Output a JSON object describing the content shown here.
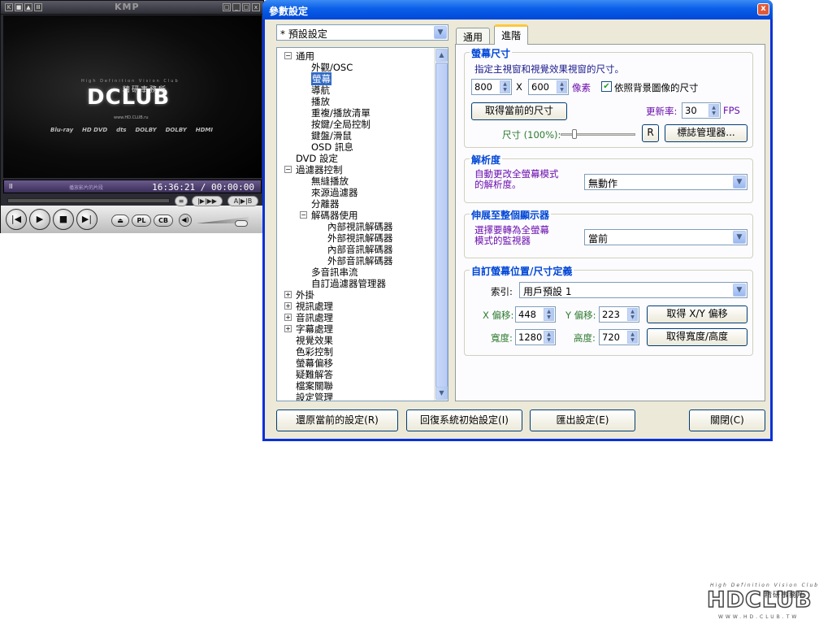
{
  "player": {
    "title": "KMP",
    "titlebar_buttons": [
      "K",
      "■",
      "▲",
      "Ⅲ"
    ],
    "window_buttons": [
      "□",
      "_",
      "□",
      "x"
    ],
    "logo_tagline": "High Definition Vision Club",
    "logo_main": "DCLUB",
    "logo_cn": "精研事務所",
    "logo_url": "www.HD.CLUB.ru",
    "formats": [
      "Blu-ray",
      "HD DVD",
      "dts",
      "DOLBY",
      "DOLBY",
      "HDMI"
    ],
    "play_indicator": "II",
    "status_text": "播放影片的片段",
    "timecode": "16:36:21 / 00:00:00",
    "buttons": {
      "list": "≡",
      "frame": "|▶|▶▶",
      "ab": "A|▶|B",
      "pl": "PL",
      "cb": "CB"
    }
  },
  "dialog": {
    "title": "參數設定",
    "close": "x",
    "preset": "* 預設設定",
    "tabs": [
      "通用",
      "進階"
    ],
    "tree": {
      "items": [
        "通用",
        "外觀/OSC",
        "螢幕",
        "導航",
        "播放",
        "重複/播放清單",
        "按鍵/全局控制",
        "鍵盤/滑鼠",
        "OSD 訊息",
        "DVD 設定",
        "過濾器控制",
        "無縫播放",
        "來源過濾器",
        "分離器",
        "解碼器使用",
        "內部視訊解碼器",
        "外部視訊解碼器",
        "內部音訊解碼器",
        "外部音訊解碼器",
        "多音訊串流",
        "自訂過濾器管理器",
        "外掛",
        "視訊處理",
        "音訊處理",
        "字幕處理",
        "視覺效果",
        "色彩控制",
        "螢幕偏移",
        "疑難解答",
        "檔案關聯",
        "設定管理"
      ]
    },
    "screen_size": {
      "label": "螢幕尺寸",
      "desc": "指定主視窗和視覺效果視窗的尺寸。",
      "width": "800",
      "x": "X",
      "height": "600",
      "unit": "像素",
      "checkbox": "依照背景圖像的尺寸",
      "get_current": "取得當前的尺寸",
      "refresh_label": "更新率:",
      "refresh": "30",
      "fps": "FPS",
      "size_label": "尺寸 (100%):",
      "r_button": "R",
      "marker_button": "標誌管理器..."
    },
    "resolution": {
      "label": "解析度",
      "desc1": "自動更改全螢幕模式",
      "desc2": "的解析度。",
      "value": "無動作"
    },
    "stretch": {
      "label": "伸展至整個顯示器",
      "desc1": "選擇要轉為全螢幕",
      "desc2": "模式的監視器",
      "value": "當前"
    },
    "custom": {
      "label": "自訂螢幕位置/尺寸定義",
      "index_label": "索引:",
      "index_value": "用戶預設 1",
      "x_label": "X 偏移:",
      "x_value": "448",
      "y_label": "Y 偏移:",
      "y_value": "223",
      "get_xy": "取得 X/Y 偏移",
      "w_label": "寬度:",
      "w_value": "1280",
      "h_label": "高度:",
      "h_value": "720",
      "get_wh": "取得寬度/高度"
    },
    "buttons": {
      "restore": "還原當前的設定(R)",
      "reset": "回復系統初始設定(I)",
      "export": "匯出設定(E)",
      "close": "關閉(C)"
    }
  },
  "watermark": {
    "tagline": "High Definition Vision Club",
    "main": "HDCLUB",
    "cn": "精研事務所",
    "url": "WWW.HD.CLUB.TW"
  },
  "colors": {
    "accent": "#0046d5",
    "titlebar": "#0a5ee8",
    "selection": "#316ac5"
  }
}
